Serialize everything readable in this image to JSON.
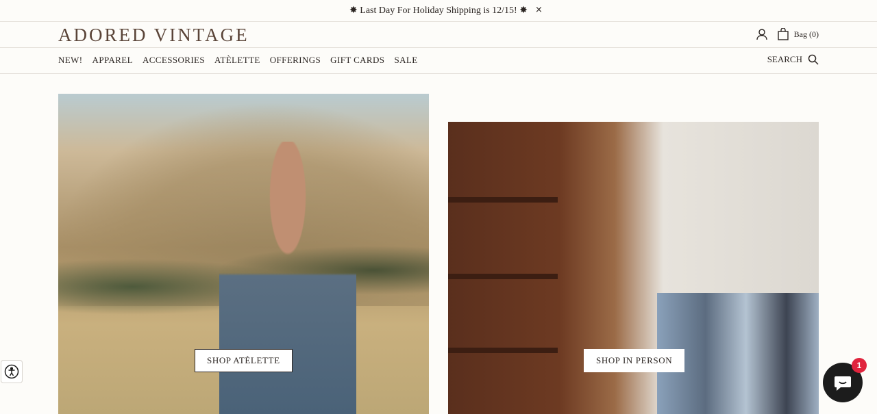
{
  "announcement": {
    "text": "✸ Last Day For Holiday Shipping is 12/15! ✸",
    "close_glyph": "×"
  },
  "header": {
    "logo": "ADORED VINTAGE",
    "bag_label": "Bag (0)"
  },
  "nav": {
    "items": [
      "NEW!",
      "APPAREL",
      "ACCESSORIES",
      "ATÈLETTE",
      "OFFERINGS",
      "GIFT CARDS",
      "SALE"
    ],
    "search_label": "SEARCH"
  },
  "hero": {
    "left_button": "SHOP ATÈLETTE",
    "right_button": "SHOP IN PERSON"
  },
  "chat": {
    "badge_count": "1"
  },
  "colors": {
    "logo": "#5a4438",
    "background": "#fdfcf9",
    "badge": "#e0243d"
  }
}
